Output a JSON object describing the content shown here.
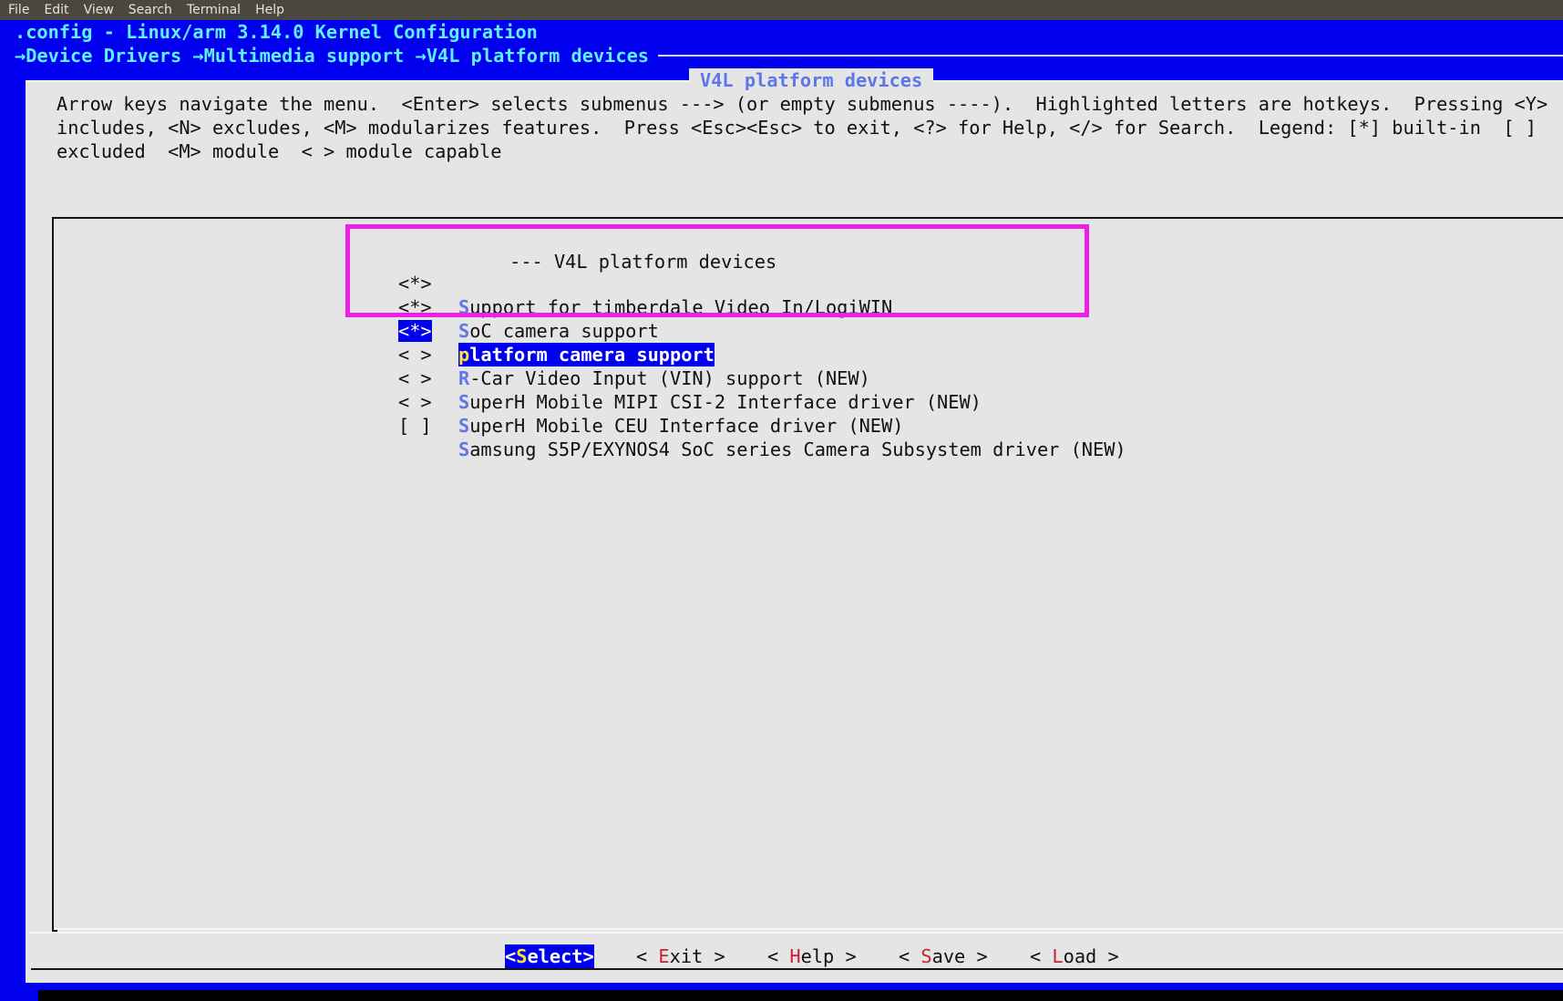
{
  "window_menu": [
    "File",
    "Edit",
    "View",
    "Search",
    "Terminal",
    "Help"
  ],
  "header": {
    "title": ".config - Linux/arm 3.14.0 Kernel Configuration",
    "breadcrumb": [
      {
        "arrow": "→",
        "label": "Device Drivers "
      },
      {
        "arrow": "→",
        "label": "Multimedia support "
      },
      {
        "arrow": "→",
        "label": "V4L platform devices"
      }
    ]
  },
  "dialog": {
    "title": "V4L platform devices",
    "help_lines": [
      "Arrow keys navigate the menu.  <Enter> selects submenus ---> (or empty submenus ----).  Highlighted letters are hotkeys.  Pressing <Y>",
      "includes, <N> excludes, <M> modularizes features.  Press <Esc><Esc> to exit, <?> for Help, </> for Search.  Legend: [*] built-in  [ ]",
      "excluded  <M> module  < > module capable"
    ]
  },
  "menu": {
    "header_line": "--- V4L platform devices",
    "items": [
      {
        "state": "<*>",
        "hotkey": "S",
        "rest": "upport for timberdale Video In/LogiWIN",
        "selected": false
      },
      {
        "state": "<*>",
        "hotkey": "S",
        "rest": "oC camera support",
        "selected": false
      },
      {
        "state": "<*>",
        "hotkey": "p",
        "rest": "latform camera support",
        "selected": true
      },
      {
        "state": "< >",
        "hotkey": "R",
        "rest": "-Car Video Input (VIN) support (NEW)",
        "selected": false
      },
      {
        "state": "< >",
        "hotkey": "S",
        "rest": "uperH Mobile MIPI CSI-2 Interface driver (NEW)",
        "selected": false
      },
      {
        "state": "< >",
        "hotkey": "S",
        "rest": "uperH Mobile CEU Interface driver (NEW)",
        "selected": false
      },
      {
        "state": "[ ]",
        "hotkey": "S",
        "rest": "amsung S5P/EXYNOS4 SoC series Camera Subsystem driver (NEW)",
        "selected": false
      }
    ]
  },
  "buttons": {
    "select": {
      "open": "<",
      "hk": "S",
      "rest": "elect",
      "close": ">"
    },
    "exit": {
      "open": "< ",
      "hk": "E",
      "rest": "xit",
      "close": " >"
    },
    "help": {
      "open": "< ",
      "hk": "H",
      "rest": "elp",
      "close": " >"
    },
    "save": {
      "open": "< ",
      "hk": "S",
      "rest": "ave",
      "close": " >"
    },
    "load": {
      "open": "< ",
      "hk": "L",
      "rest": "oad",
      "close": " >"
    }
  },
  "colors": {
    "terminal_bg": "#0000ee",
    "header_text": "#5ef0ff",
    "dialog_bg": "#e5e5e5",
    "hotkey": "#5e76e8",
    "button_hotkey": "#c8232c",
    "selected_hotkey": "#ffe23a",
    "annotation": "#f01fe6"
  }
}
